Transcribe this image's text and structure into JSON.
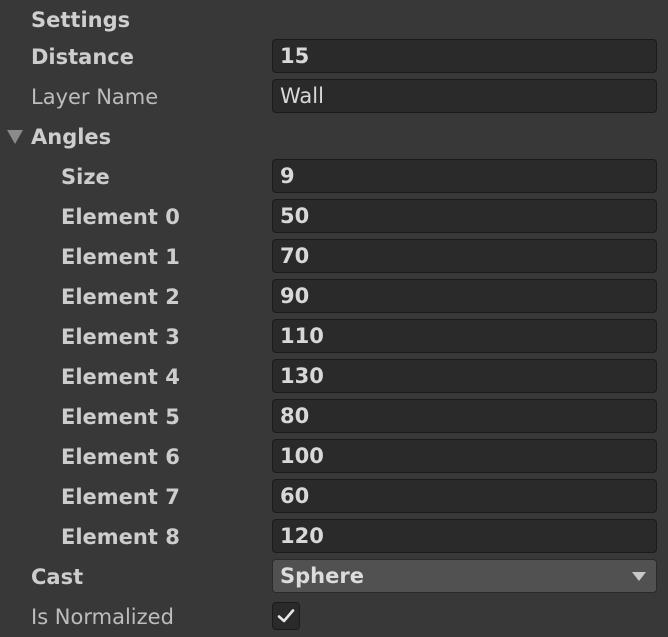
{
  "settings_header": "Settings",
  "distance": {
    "label": "Distance",
    "value": "15"
  },
  "layer_name": {
    "label": "Layer Name",
    "value": "Wall"
  },
  "angles": {
    "label": "Angles",
    "expanded": true,
    "size": {
      "label": "Size",
      "value": "9"
    },
    "elements": [
      {
        "label": "Element 0",
        "value": "50"
      },
      {
        "label": "Element 1",
        "value": "70"
      },
      {
        "label": "Element 2",
        "value": "90"
      },
      {
        "label": "Element 3",
        "value": "110"
      },
      {
        "label": "Element 4",
        "value": "130"
      },
      {
        "label": "Element 5",
        "value": "80"
      },
      {
        "label": "Element 6",
        "value": "100"
      },
      {
        "label": "Element 7",
        "value": "60"
      },
      {
        "label": "Element 8",
        "value": "120"
      }
    ]
  },
  "cast": {
    "label": "Cast",
    "selected": "Sphere"
  },
  "is_normalized": {
    "label": "Is Normalized",
    "checked": true
  },
  "icons": {
    "foldout": "triangle-down-icon",
    "dropdown": "caret-down-icon",
    "check": "checkmark-icon"
  }
}
